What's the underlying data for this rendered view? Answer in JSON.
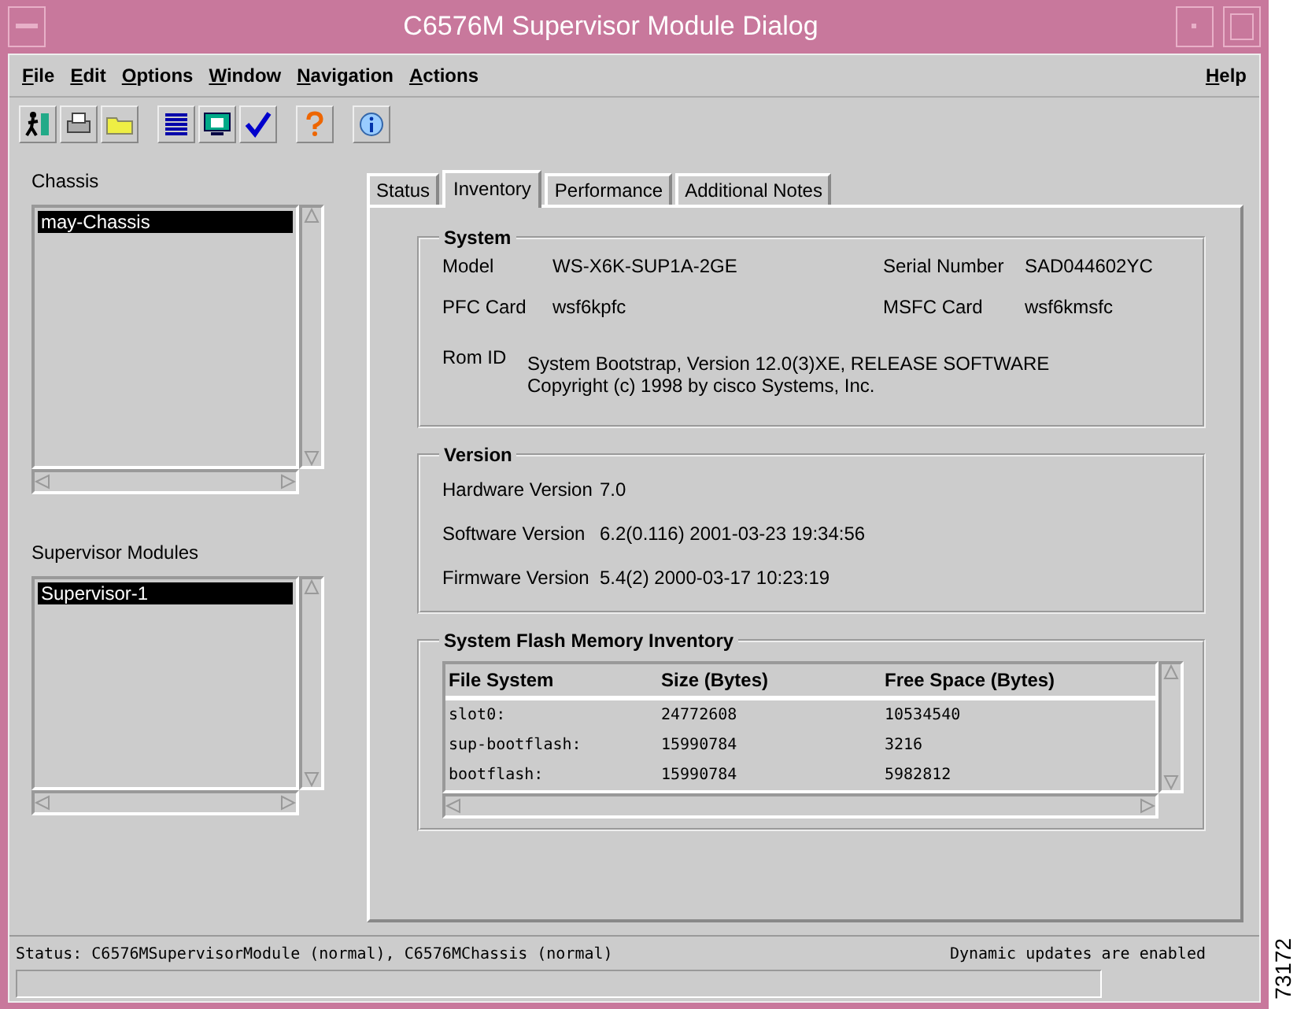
{
  "window": {
    "title": "C6576M Supervisor Module Dialog"
  },
  "menu": {
    "items": [
      "File",
      "Edit",
      "Options",
      "Window",
      "Navigation",
      "Actions"
    ],
    "help": "Help"
  },
  "chassis": {
    "label": "Chassis",
    "items": [
      {
        "label": "may-Chassis",
        "selected": true
      }
    ]
  },
  "supervisor_modules": {
    "label": "Supervisor Modules",
    "items": [
      {
        "label": "Supervisor-1",
        "selected": true
      }
    ]
  },
  "tabs": [
    {
      "label": "Status",
      "selected": false
    },
    {
      "label": "Inventory",
      "selected": true
    },
    {
      "label": "Performance",
      "selected": false
    },
    {
      "label": "Additional Notes",
      "selected": false
    }
  ],
  "system": {
    "title": "System",
    "model": {
      "label": "Model",
      "value": "WS-X6K-SUP1A-2GE"
    },
    "serial_number": {
      "label": "Serial Number",
      "value": "SAD044602YC"
    },
    "pfc_card": {
      "label": "PFC Card",
      "value": "wsf6kpfc"
    },
    "msfc_card": {
      "label": "MSFC Card",
      "value": "wsf6kmsfc"
    },
    "rom_id": {
      "label": "Rom ID",
      "lines": [
        "System Bootstrap, Version 12.0(3)XE, RELEASE SOFTWARE",
        "Copyright (c) 1998 by cisco Systems, Inc."
      ]
    }
  },
  "version": {
    "title": "Version",
    "fields": [
      {
        "label": "Hardware Version",
        "value": "7.0"
      },
      {
        "label": "Software Version",
        "value": "6.2(0.116) 2001-03-23 19:34:56"
      },
      {
        "label": "Firmware Version",
        "value": "5.4(2) 2000-03-17 10:23:19"
      }
    ]
  },
  "flash": {
    "title": "System Flash Memory Inventory",
    "columns": [
      "File System",
      "Size (Bytes)",
      "Free Space (Bytes)"
    ],
    "rows": [
      [
        "slot0:",
        "24772608",
        "10534540"
      ],
      [
        "sup-bootflash:",
        "15990784",
        "3216"
      ],
      [
        "bootflash:",
        "15990784",
        "5982812"
      ]
    ]
  },
  "status_bar": {
    "status": "Status: C6576MSupervisorModule (normal), C6576MChassis (normal)",
    "updates": "Dynamic updates are enabled"
  },
  "figure_id": "73172"
}
